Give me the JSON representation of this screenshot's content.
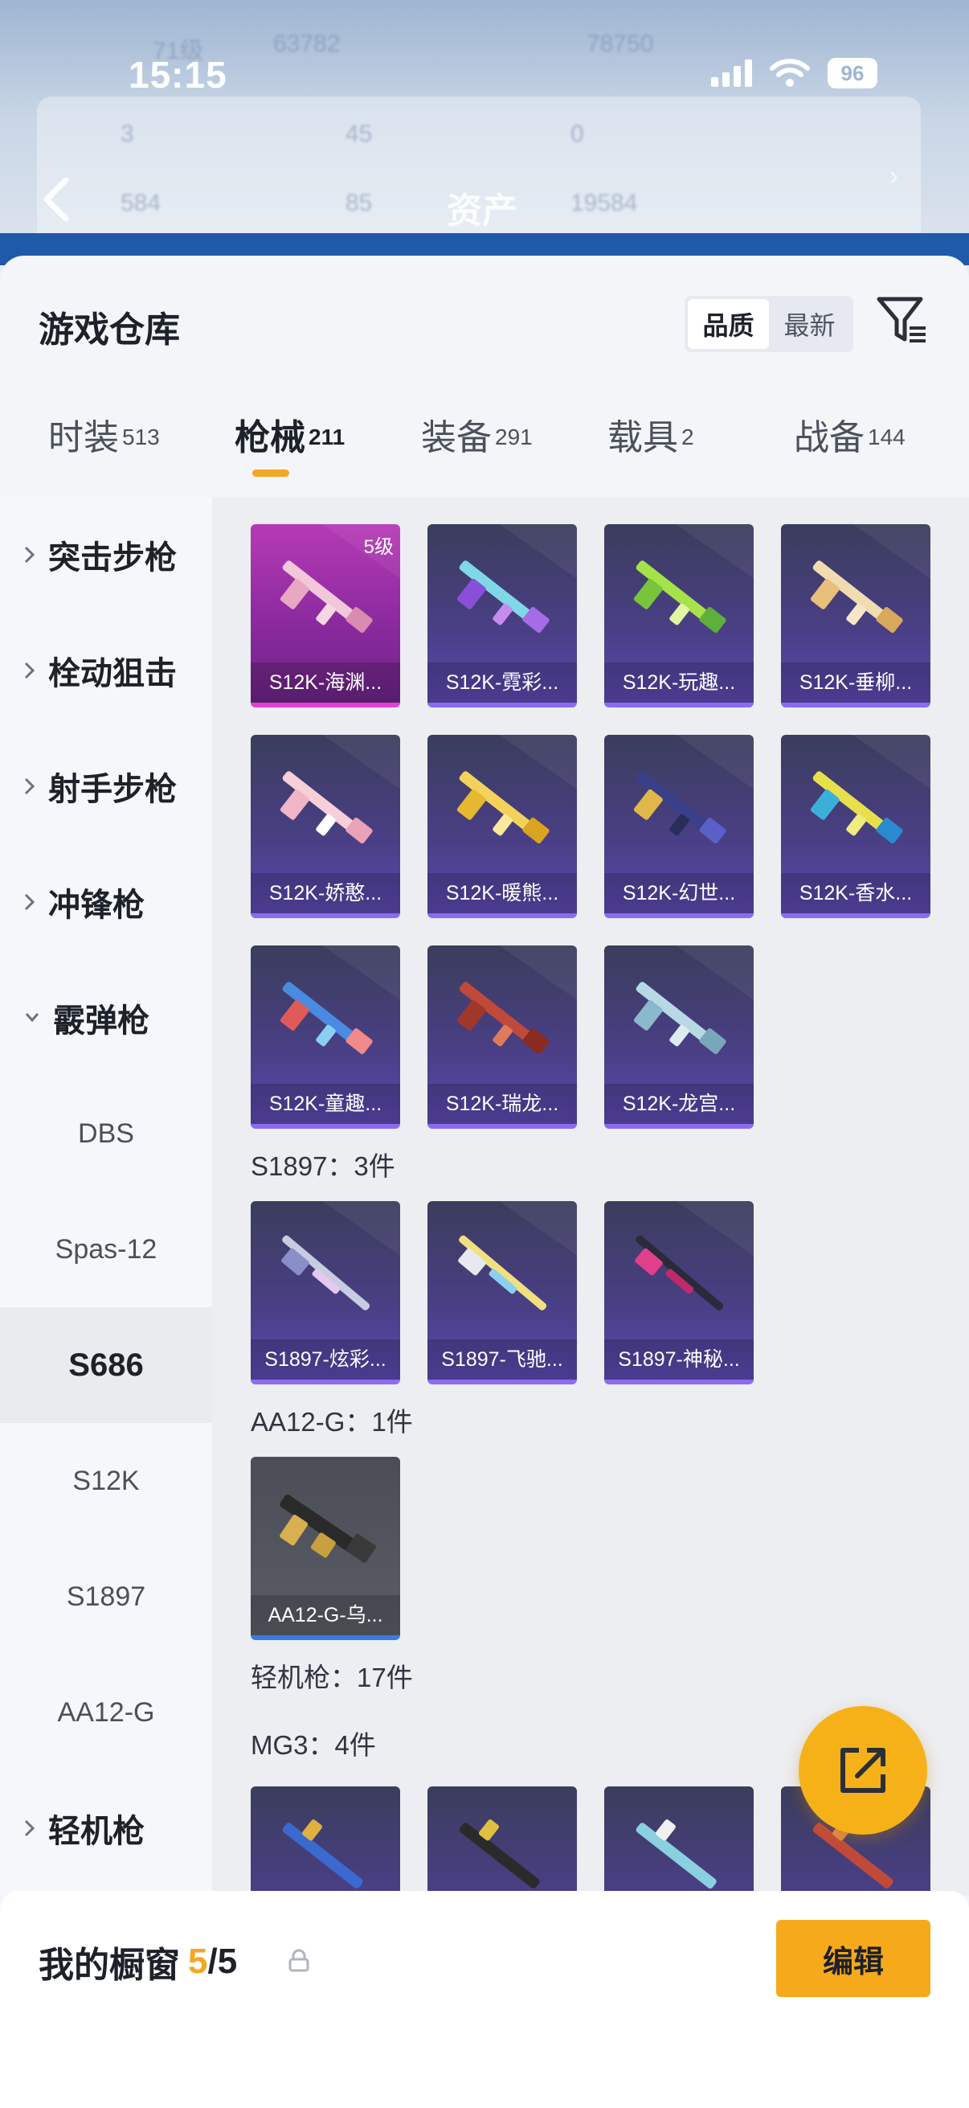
{
  "status_bar": {
    "time": "15:15",
    "battery": "96"
  },
  "background_header": {
    "level": "71级",
    "coins": "63782",
    "points": "78750",
    "stat_a": "3",
    "stat_b": "45",
    "stat_c": "0",
    "stat_d": "584",
    "stat_e": "85",
    "stat_f": "19584",
    "title": "资产"
  },
  "sheet": {
    "title": "游戏仓库",
    "sort_options": [
      "品质",
      "最新"
    ],
    "active_sort": "品质"
  },
  "tabs": [
    {
      "label": "时装",
      "count": "513"
    },
    {
      "label": "枪械",
      "count": "211"
    },
    {
      "label": "装备",
      "count": "291"
    },
    {
      "label": "载具",
      "count": "2"
    },
    {
      "label": "战备",
      "count": "144"
    }
  ],
  "active_tab": "枪械",
  "left_nav": [
    {
      "label": "突击步枪",
      "type": "category"
    },
    {
      "label": "栓动狙击",
      "type": "category"
    },
    {
      "label": "射手步枪",
      "type": "category"
    },
    {
      "label": "冲锋枪",
      "type": "category"
    },
    {
      "label": "霰弹枪",
      "type": "category-open"
    },
    {
      "label": "DBS",
      "type": "sub"
    },
    {
      "label": "Spas-12",
      "type": "sub"
    },
    {
      "label": "S686",
      "type": "sub-selected"
    },
    {
      "label": "S12K",
      "type": "sub"
    },
    {
      "label": "S1897",
      "type": "sub"
    },
    {
      "label": "AA12-G",
      "type": "sub"
    },
    {
      "label": "轻机枪",
      "type": "category"
    }
  ],
  "items": {
    "s12k": [
      {
        "name": "S12K-海渊...",
        "level": "5级",
        "rarity": "legend"
      },
      {
        "name": "S12K-霓彩..."
      },
      {
        "name": "S12K-玩趣..."
      },
      {
        "name": "S12K-垂柳..."
      },
      {
        "name": "S12K-娇憨..."
      },
      {
        "name": "S12K-暖熊..."
      },
      {
        "name": "S12K-幻世..."
      },
      {
        "name": "S12K-香水..."
      },
      {
        "name": "S12K-童趣..."
      },
      {
        "name": "S12K-瑞龙..."
      },
      {
        "name": "S12K-龙宫..."
      }
    ],
    "s1897_label": "S1897：3件",
    "s1897": [
      {
        "name": "S1897-炫彩..."
      },
      {
        "name": "S1897-飞驰..."
      },
      {
        "name": "S1897-神秘..."
      }
    ],
    "aa12g_label": "AA12-G：1件",
    "aa12g": [
      {
        "name": "AA12-G-乌..."
      }
    ],
    "lmg_label": "轻机枪：17件",
    "mg3_label": "MG3：4件"
  },
  "bottom": {
    "showcase_label": "我的橱窗",
    "showcase_current": "5",
    "showcase_separator": "/",
    "showcase_total": "5",
    "edit_label": "编辑"
  },
  "colors": {
    "accent": "#f5a623",
    "edit_button": "#f7a91c",
    "fab": "#f7b118",
    "card_legend": "#b63ab6",
    "card_epic": "#4a3f86"
  }
}
